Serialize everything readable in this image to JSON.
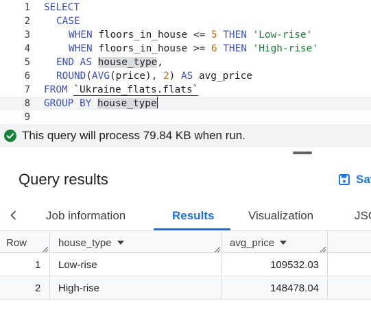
{
  "editor": {
    "line_numbers": [
      "1",
      "2",
      "3",
      "4",
      "5",
      "6",
      "7",
      "8",
      "9"
    ],
    "l1": {
      "kw": "SELECT"
    },
    "l2": {
      "kw": "CASE"
    },
    "l3": {
      "kw_when": "WHEN",
      "ident": " floors_in_house <= ",
      "num": "5",
      "kw_then": " THEN ",
      "str": "'Low-rise'"
    },
    "l4": {
      "kw_when": "WHEN",
      "ident": " floors_in_house >= ",
      "num": "6",
      "kw_then": " THEN ",
      "str": "'High-rise'"
    },
    "l5": {
      "kw": "END AS ",
      "alias": "house_type",
      "rest": ","
    },
    "l6": {
      "fn1": "ROUND",
      "p1": "(",
      "fn2": "AVG",
      "p2": "(price), ",
      "num": "2",
      "p3": ") ",
      "kw": "AS",
      "alias": " avg_price"
    },
    "l7": {
      "kw": "FROM",
      "sp": " ",
      "table": "`Ukraine_flats.flats`"
    },
    "l8": {
      "kw": "GROUP BY",
      "sp": " ",
      "alias": "house_type"
    }
  },
  "validator": {
    "icon": "check-circle-icon",
    "message": "This query will process 79.84 KB when run."
  },
  "results": {
    "title": "Query results",
    "save_label": "Save",
    "tabs": [
      {
        "label": "Job information"
      },
      {
        "label": "Results",
        "active": true
      },
      {
        "label": "Visualization"
      },
      {
        "label": "JSON"
      }
    ]
  },
  "table": {
    "columns": [
      "Row",
      "house_type",
      "avg_price"
    ],
    "rows": [
      {
        "row": "1",
        "house_type": "Low-rise",
        "avg_price": "109532.03"
      },
      {
        "row": "2",
        "house_type": "High-rise",
        "avg_price": "148478.04"
      }
    ]
  },
  "colors": {
    "accent": "#1a73e8",
    "keyword": "#3b4fd6",
    "number": "#c5701a",
    "string": "#1a7f37",
    "success": "#188038"
  }
}
